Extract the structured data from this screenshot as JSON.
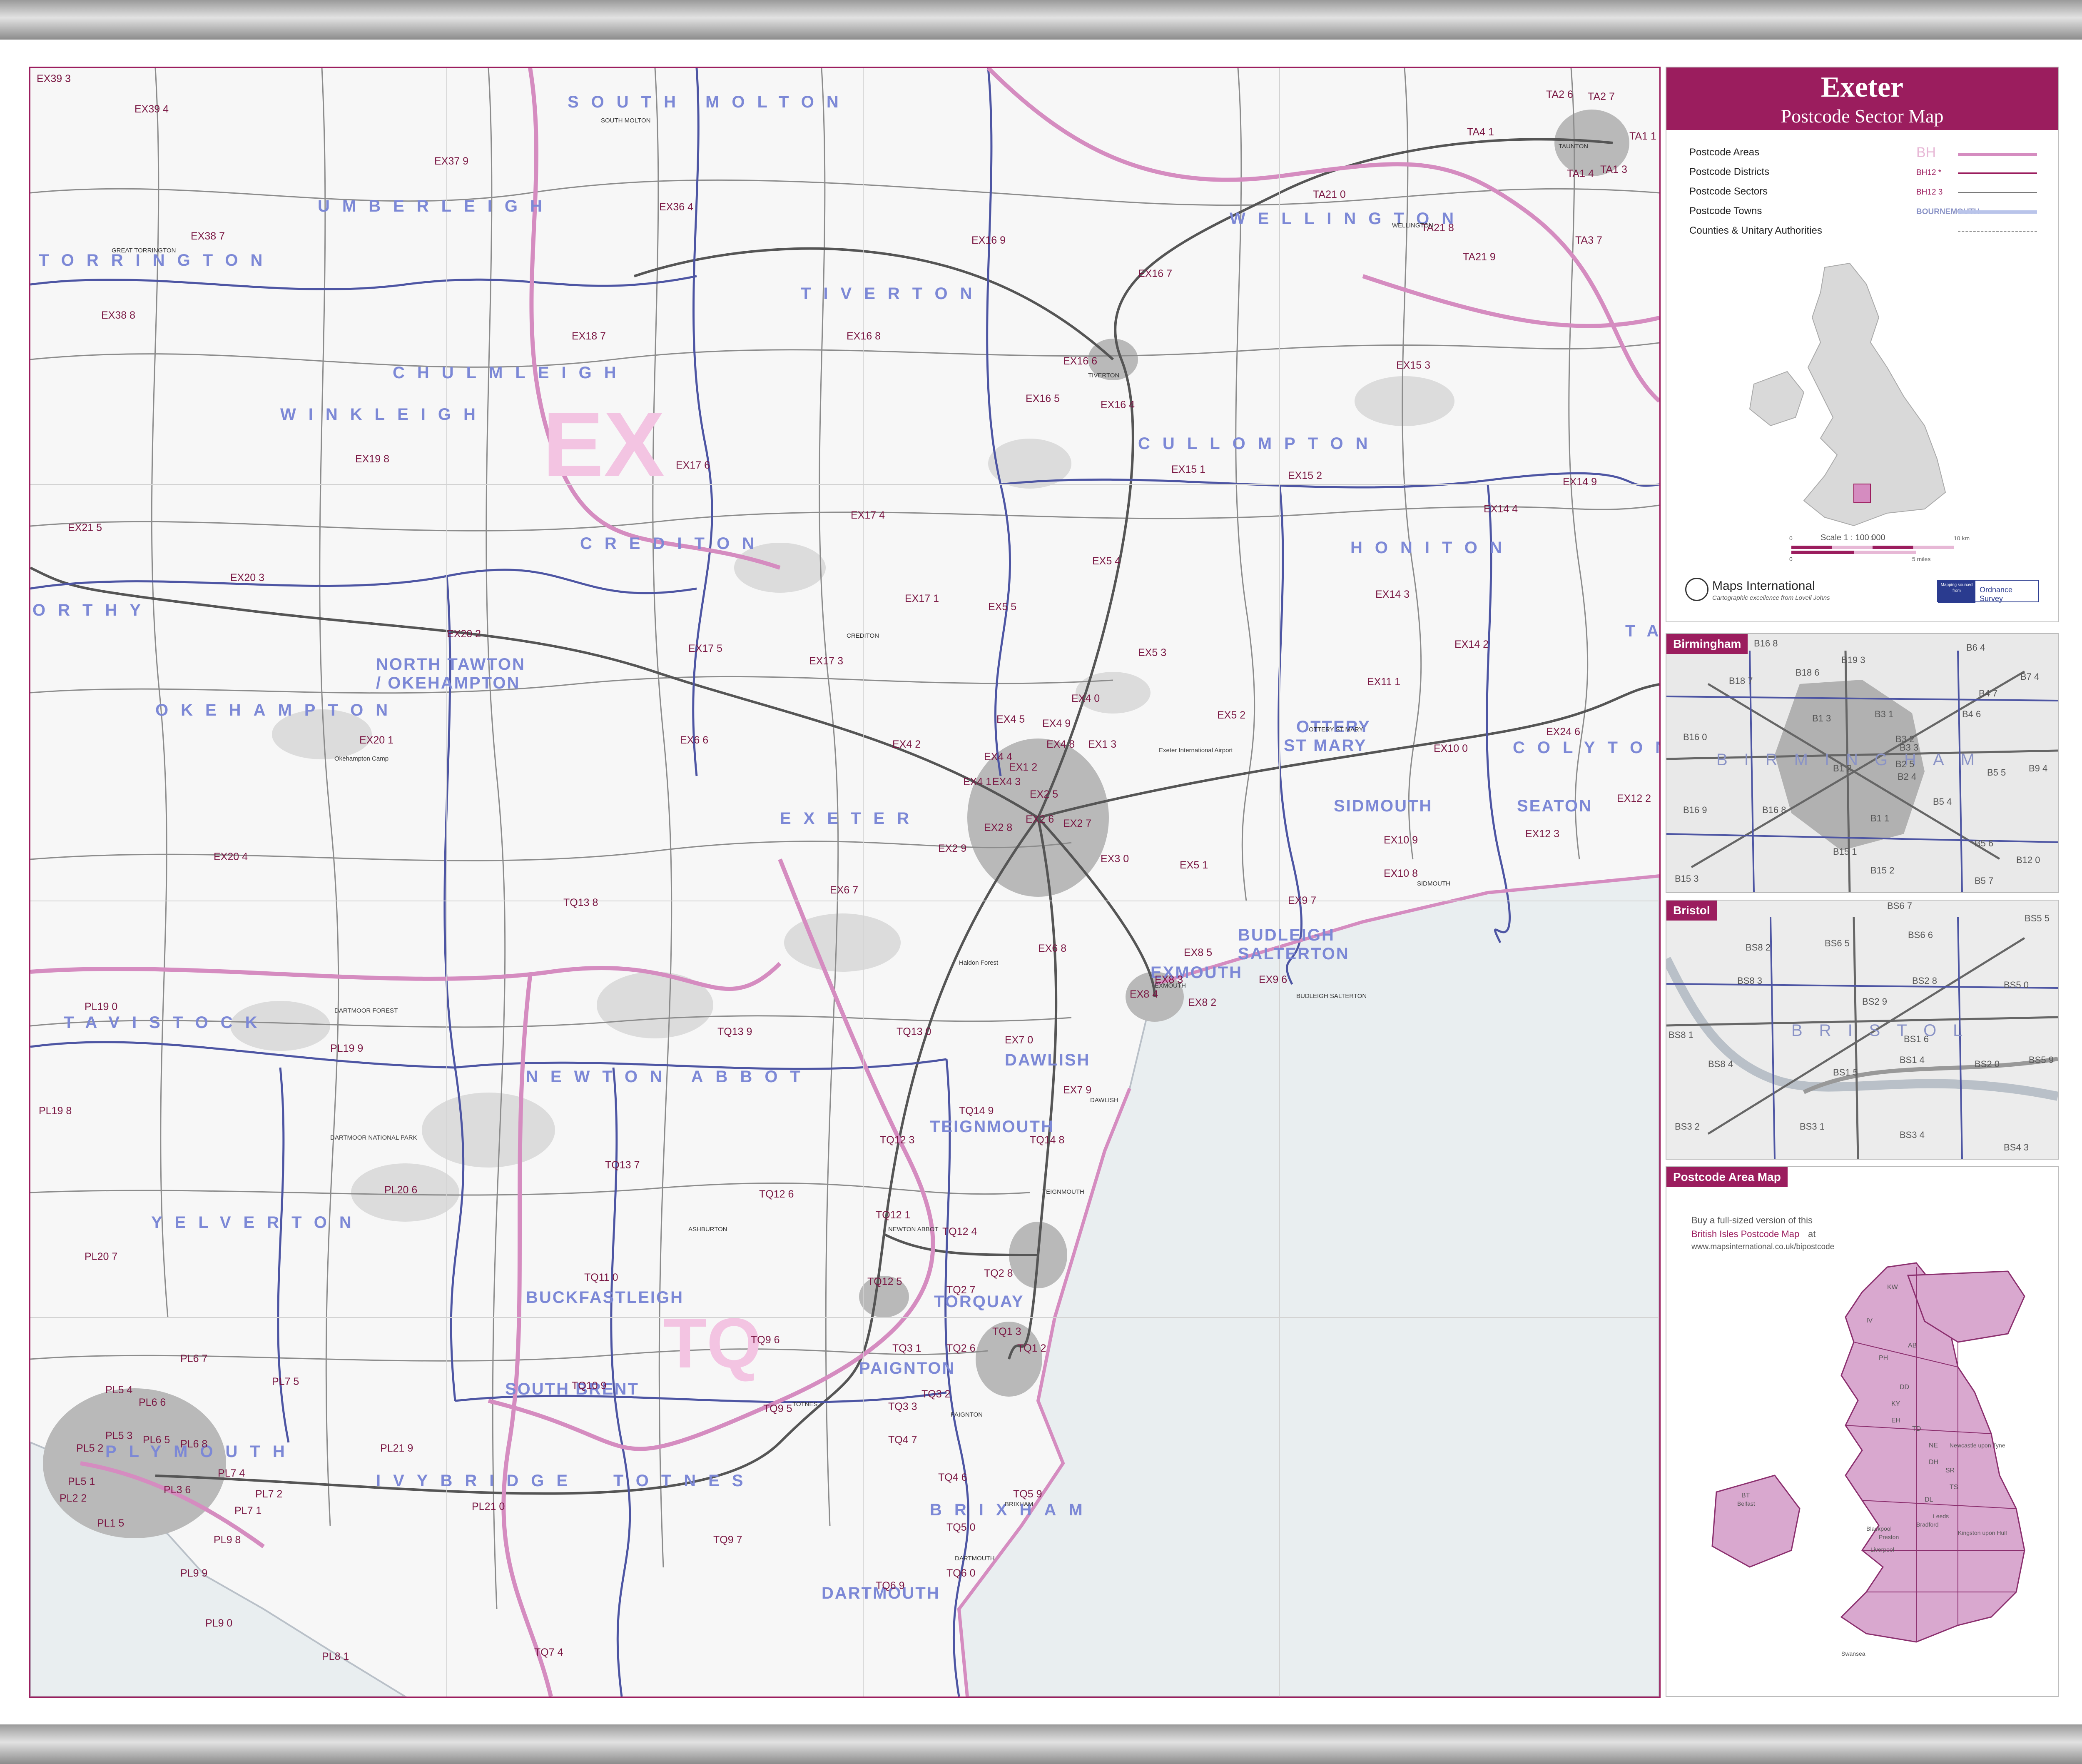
{
  "header": {
    "title": "Exeter",
    "subtitle": "Postcode Sector Map"
  },
  "legend": {
    "items": [
      {
        "label": "Postcode Areas",
        "code": "BH"
      },
      {
        "label": "Postcode Districts",
        "code": "BH12 *"
      },
      {
        "label": "Postcode Sectors",
        "code": "BH12 3"
      },
      {
        "label": "Postcode Towns",
        "code": "BOURNEMOUTH"
      },
      {
        "label": "Counties & Unitary Authorities",
        "code": ""
      }
    ],
    "colors": {
      "area": "#d58cc0",
      "district": "#9b1d5e",
      "sector": "#7a7a7a",
      "town": "#b9c4ea",
      "county": "#999999"
    }
  },
  "overview": {
    "scale_label": "Scale 1 : 100 000",
    "scale_km": [
      "0",
      "5",
      "10 km"
    ],
    "scale_miles": [
      "0",
      "5 miles"
    ],
    "publisher": "Maps International",
    "publisher_tagline": "Cartographic excellence from Lovell Johns",
    "partner": "Ordnance Survey",
    "partner_badge": "Mapping sourced from"
  },
  "towns": [
    "SOUTH MOLTON",
    "UMBERLEIGH",
    "TORRINGTON",
    "TIVERTON",
    "WELLINGTON",
    "CHULMLEIGH",
    "WINKLEIGH",
    "CULLOMPTON",
    "CREDITON",
    "HONITON",
    "NORTH TAWTON",
    "/ OKEHAMPTON",
    "OKEHAMPTON",
    "OTTERY",
    "ST MARY",
    "COLYTON",
    "EXETER",
    "SIDMOUTH",
    "SEATON",
    "BUDLEIGH",
    "SALTERTON",
    "EXMOUTH",
    "TAVISTOCK",
    "NEWTON ABBOT",
    "DAWLISH",
    "TEIGNMOUTH",
    "YELVERTON",
    "BUCKFASTLEIGH",
    "TORQUAY",
    "SOUTH BRENT",
    "PAIGNTON",
    "PLYMOUTH",
    "IVYBRIDGE",
    "TOTNES",
    "BRIXHAM",
    "DARTMOUTH",
    "TA",
    "ORTHY"
  ],
  "sectors": [
    "EX39 3",
    "EX39 4",
    "EX37 9",
    "EX36 4",
    "EX38 7",
    "EX38 8",
    "EX18 7",
    "EX19 8",
    "EX17 6",
    "EX21 5",
    "EX20 3",
    "EX20 2",
    "EX20 1",
    "EX20 4",
    "EX17 5",
    "EX17 3",
    "EX17 4",
    "EX17 1",
    "EX16 9",
    "EX16 7",
    "EX16 8",
    "EX16 6",
    "EX16 5",
    "EX16 4",
    "EX15 1",
    "EX15 2",
    "EX15 3",
    "EX14 4",
    "EX14 3",
    "EX14 2",
    "EX14 9",
    "EX11 1",
    "EX10 0",
    "EX10 9",
    "EX10 8",
    "EX24 6",
    "EX12 2",
    "EX12 3",
    "EX5 4",
    "EX5 5",
    "EX5 3",
    "EX5 2",
    "EX5 1",
    "EX4 0",
    "EX4 5",
    "EX4 9",
    "EX4 8",
    "EX4 4",
    "EX4 1",
    "EX4 2",
    "EX4 3",
    "EX1 2",
    "EX1 3",
    "EX2 5",
    "EX2 6",
    "EX2 7",
    "EX2 8",
    "EX2 9",
    "EX6 6",
    "EX6 7",
    "EX6 8",
    "EX3 0",
    "EX8 5",
    "EX8 2",
    "EX8 3",
    "EX8 4",
    "EX9 6",
    "EX9 7",
    "EX7 0",
    "EX7 9",
    "TA2 6",
    "TA2 7",
    "TA4 1",
    "TA1 4",
    "TA1 3",
    "TA1 1",
    "TA21 0",
    "TA21 8",
    "TA21 9",
    "TA3 7",
    "TQ13 8",
    "TQ13 9",
    "TQ13 0",
    "TQ13 7",
    "TQ14 9",
    "TQ14 8",
    "TQ12 3",
    "TQ12 6",
    "TQ12 1",
    "TQ12 4",
    "TQ12 5",
    "TQ11 0",
    "TQ10 9",
    "TQ9 6",
    "TQ9 5",
    "TQ9 7",
    "TQ2 8",
    "TQ2 7",
    "TQ2 6",
    "TQ1 3",
    "TQ1 2",
    "TQ3 1",
    "TQ3 2",
    "TQ3 3",
    "TQ4 7",
    "TQ4 6",
    "TQ5 9",
    "TQ5 0",
    "TQ6 0",
    "TQ6 9",
    "TQ7 4",
    "PL19 0",
    "PL19 9",
    "PL19 8",
    "PL20 6",
    "PL20 7",
    "PL21 9",
    "PL21 0",
    "PL6 7",
    "PL6 6",
    "PL5 4",
    "PL5 3",
    "PL5 2",
    "PL5 1",
    "PL6 5",
    "PL6 8",
    "PL7 5",
    "PL7 4",
    "PL7 1",
    "PL7 2",
    "PL2 2",
    "PL1 5",
    "PL3 6",
    "PL9 8",
    "PL9 9",
    "PL9 0",
    "PL8 1"
  ],
  "places": [
    "SOUTH MOLTON",
    "GREAT TORRINGTON",
    "TIVERTON",
    "WELLINGTON",
    "CREDITON",
    "OTTERY ST MARY",
    "SIDMOUTH",
    "BUDLEIGH SALTERTON",
    "EXMOUTH",
    "DAWLISH",
    "TEIGNMOUTH",
    "NEWTON ABBOT",
    "ASHBURTON",
    "TOTNES",
    "PAIGNTON",
    "BRIXHAM",
    "DARTMOUTH",
    "Exeter International Airport",
    "DARTMOOR NATIONAL PARK",
    "DARTMOOR FOREST",
    "Okehampton Camp",
    "TAUNTON",
    "Haldon Forest"
  ],
  "insets": {
    "birmingham": {
      "tab": "Birmingham",
      "town": "BIRMINGHAM",
      "sectors": [
        "B16 8",
        "B19 3",
        "B18 7",
        "B18 6",
        "B6 4",
        "B7 4",
        "B4 7",
        "B1 3",
        "B3 1",
        "B4 6",
        "B16 0",
        "B3 2",
        "B3 3",
        "B2 5",
        "B2 4",
        "B1 2",
        "B5 5",
        "B9 4",
        "B16 9",
        "B16 8",
        "B5 4",
        "B1 1",
        "B5 6",
        "B15 1",
        "B12 0",
        "B15 3",
        "B15 2",
        "B5 7"
      ]
    },
    "bristol": {
      "tab": "Bristol",
      "town": "BRISTOL",
      "sectors": [
        "BS6 7",
        "BS6 6",
        "BS5 5",
        "BS8 2",
        "BS6 5",
        "BS2 8",
        "BS8 3",
        "BS5 0",
        "BS2 9",
        "BS8 1",
        "BS1 4",
        "BS2 0",
        "BS5 9",
        "BS8 4",
        "BS1 5",
        "BS1 6",
        "BS3 1",
        "BS3 4",
        "BS3 2",
        "BS4 3"
      ]
    }
  },
  "area_map": {
    "tab": "Postcode Area Map",
    "promo_line1": "Buy a full-sized version of this",
    "promo_link": "British Isles Postcode Map",
    "promo_line2": "at",
    "promo_url": "www.mapsinternational.co.uk/bipostcode",
    "labels": [
      "KW",
      "IV",
      "AB",
      "PH",
      "DD",
      "KY",
      "EH",
      "TD",
      "NE",
      "DH",
      "SR",
      "TS",
      "DL",
      "BT",
      "Belfast",
      "Newcastle upon Tyne",
      "Blackpool",
      "Preston",
      "Liverpool",
      "Kingston upon Hull",
      "Swansea",
      "Bradford",
      "Leeds"
    ]
  }
}
